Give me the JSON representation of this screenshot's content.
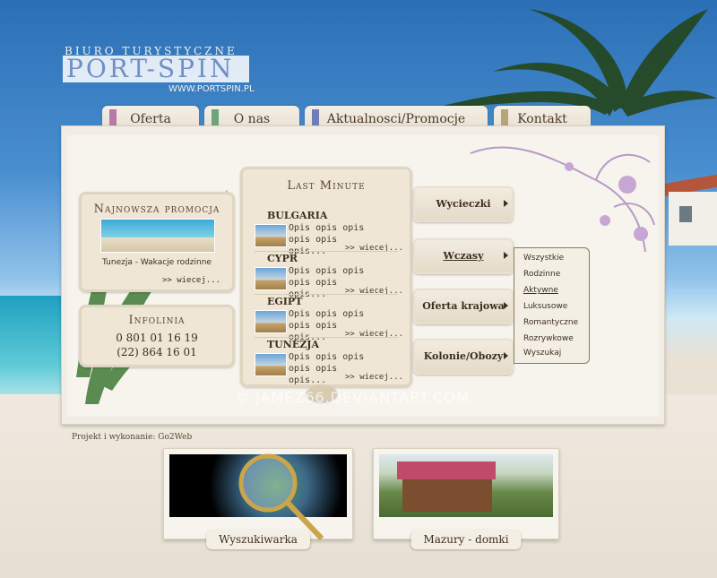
{
  "brand": {
    "tagline": "Biuro turystyczne",
    "name": "Port-Spin",
    "url": "www.portspin.pl"
  },
  "tabs": [
    {
      "label": "Oferta",
      "color": "#b57aa6"
    },
    {
      "label": "O nas",
      "color": "#6fa47a"
    },
    {
      "label": "Aktualnosci/Promocje",
      "color": "#6f7fb5"
    },
    {
      "label": "Kontakt",
      "color": "#b6a47a"
    }
  ],
  "promo": {
    "title": "Najnowsza promocja",
    "caption": "Tunezja - Wakacje rodzinne",
    "more": ">> wiecej..."
  },
  "infolinia": {
    "title": "Infolinia",
    "phone1": "0 801 01 16 19",
    "phone2": "(22) 864 16 01"
  },
  "last_minute": {
    "title": "Last Minute",
    "items": [
      {
        "country": "Bulgaria",
        "desc": "Opis opis opis opis opis opis...",
        "more": ">> wiecej..."
      },
      {
        "country": "Cypr",
        "desc": "Opis opis opis opis opis opis...",
        "more": ">> wiecej..."
      },
      {
        "country": "Egipt",
        "desc": "Opis opis opis opis opis opis...",
        "more": ">> wiecej..."
      },
      {
        "country": "Tunezja",
        "desc": "Opis opis opis opis opis opis...",
        "more": ">> wiecej..."
      }
    ]
  },
  "menu": [
    {
      "label": "Wycieczki"
    },
    {
      "label": "Wczasy"
    },
    {
      "label": "Oferta krajowa"
    },
    {
      "label": "Kolonie/Obozy"
    }
  ],
  "submenu": [
    "Wszystkie",
    "Rodzinne",
    "Aktywne",
    "Luksusowe",
    "Romantyczne",
    "Rozrywkowe",
    "Wyszukaj"
  ],
  "credits": "Projekt i wykonanie: Go2Web",
  "watermark": "© JAMEZ66.DEVIANTART.COM",
  "cards": [
    {
      "label": "Wyszukiwarka"
    },
    {
      "label": "Mazury - domki"
    }
  ]
}
